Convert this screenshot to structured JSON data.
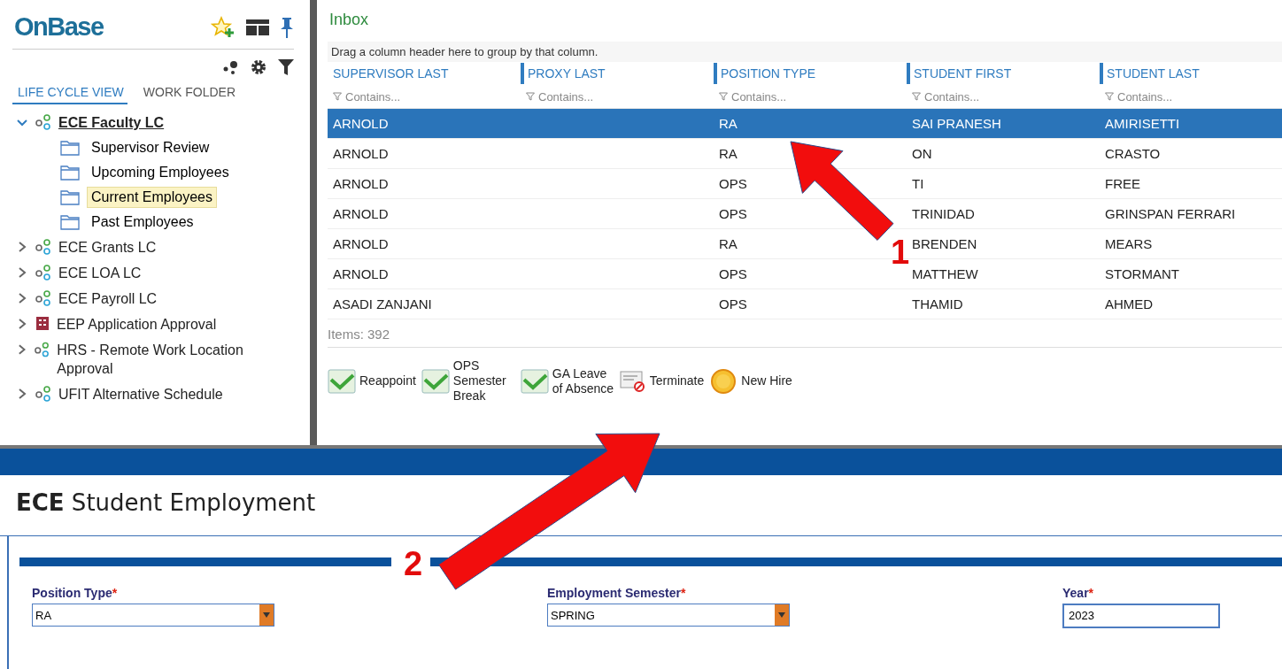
{
  "sidebar": {
    "logo": "OnBase",
    "tabs": [
      {
        "label": "LIFE CYCLE VIEW",
        "selected": true
      },
      {
        "label": "WORK FOLDER",
        "selected": false
      }
    ],
    "tree": [
      {
        "label": "ECE Faculty LC",
        "kind": "lifecycle",
        "expanded": true,
        "active": true,
        "children": [
          {
            "label": "Supervisor Review",
            "selected": false
          },
          {
            "label": "Upcoming Employees",
            "selected": false
          },
          {
            "label": "Current Employees",
            "selected": true
          },
          {
            "label": "Past Employees",
            "selected": false
          }
        ]
      },
      {
        "label": "ECE Grants LC",
        "kind": "lifecycle",
        "expanded": false,
        "active": false
      },
      {
        "label": "ECE LOA LC",
        "kind": "lifecycle",
        "expanded": false,
        "active": false
      },
      {
        "label": "ECE Payroll LC",
        "kind": "lifecycle",
        "expanded": false,
        "active": false
      },
      {
        "label": "EEP Application Approval",
        "kind": "application",
        "expanded": false,
        "active": false
      },
      {
        "label": "HRS - Remote Work Location Approval",
        "kind": "lifecycle",
        "expanded": false,
        "active": false
      },
      {
        "label": "UFIT Alternative Schedule",
        "kind": "lifecycle",
        "expanded": false,
        "active": false
      }
    ]
  },
  "inbox": {
    "title": "Inbox",
    "group_hint": "Drag a column header here to group by that column.",
    "columns": [
      {
        "label": "SUPERVISOR LAST",
        "filter_placeholder": "Contains..."
      },
      {
        "label": "PROXY LAST",
        "filter_placeholder": "Contains..."
      },
      {
        "label": "POSITION TYPE",
        "filter_placeholder": "Contains..."
      },
      {
        "label": "STUDENT FIRST",
        "filter_placeholder": "Contains..."
      },
      {
        "label": "STUDENT LAST",
        "filter_placeholder": "Contains..."
      }
    ],
    "rows": [
      {
        "selected": true,
        "cells": [
          "ARNOLD",
          "",
          "RA",
          "SAI PRANESH",
          "AMIRISETTI"
        ]
      },
      {
        "selected": false,
        "cells": [
          "ARNOLD",
          "",
          "RA",
          "ON",
          "CRASTO"
        ]
      },
      {
        "selected": false,
        "cells": [
          "ARNOLD",
          "",
          "OPS",
          "TI",
          "FREE"
        ]
      },
      {
        "selected": false,
        "cells": [
          "ARNOLD",
          "",
          "OPS",
          "TRINIDAD",
          "GRINSPAN FERRARI"
        ]
      },
      {
        "selected": false,
        "cells": [
          "ARNOLD",
          "",
          "RA",
          "BRENDEN",
          "MEARS"
        ]
      },
      {
        "selected": false,
        "cells": [
          "ARNOLD",
          "",
          "OPS",
          "MATTHEW",
          "STORMANT"
        ]
      },
      {
        "selected": false,
        "cells": [
          "ASADI ZANJANI",
          "",
          "OPS",
          "THAMID",
          "AHMED"
        ]
      }
    ],
    "item_count": "Items: 392",
    "actions": [
      {
        "label": "Reappoint",
        "kind": "check"
      },
      {
        "label": "OPS Semester Break",
        "kind": "check"
      },
      {
        "label": "GA Leave of Absence",
        "kind": "check"
      },
      {
        "label": "Terminate",
        "kind": "terminate"
      },
      {
        "label": "New Hire",
        "kind": "new"
      }
    ]
  },
  "form": {
    "title": "**ECE** Student Employment",
    "fields": [
      {
        "label": "Position Type",
        "required_mark": "*",
        "kind": "dropdown",
        "value": "RA"
      },
      {
        "label": "Employment Semester",
        "required_mark": "*",
        "kind": "dropdown",
        "value": "SPRING"
      },
      {
        "label": "Year",
        "required_mark": "*",
        "kind": "text",
        "value": "2023"
      }
    ]
  },
  "annotations": [
    {
      "label": "1"
    },
    {
      "label": "2"
    }
  ]
}
